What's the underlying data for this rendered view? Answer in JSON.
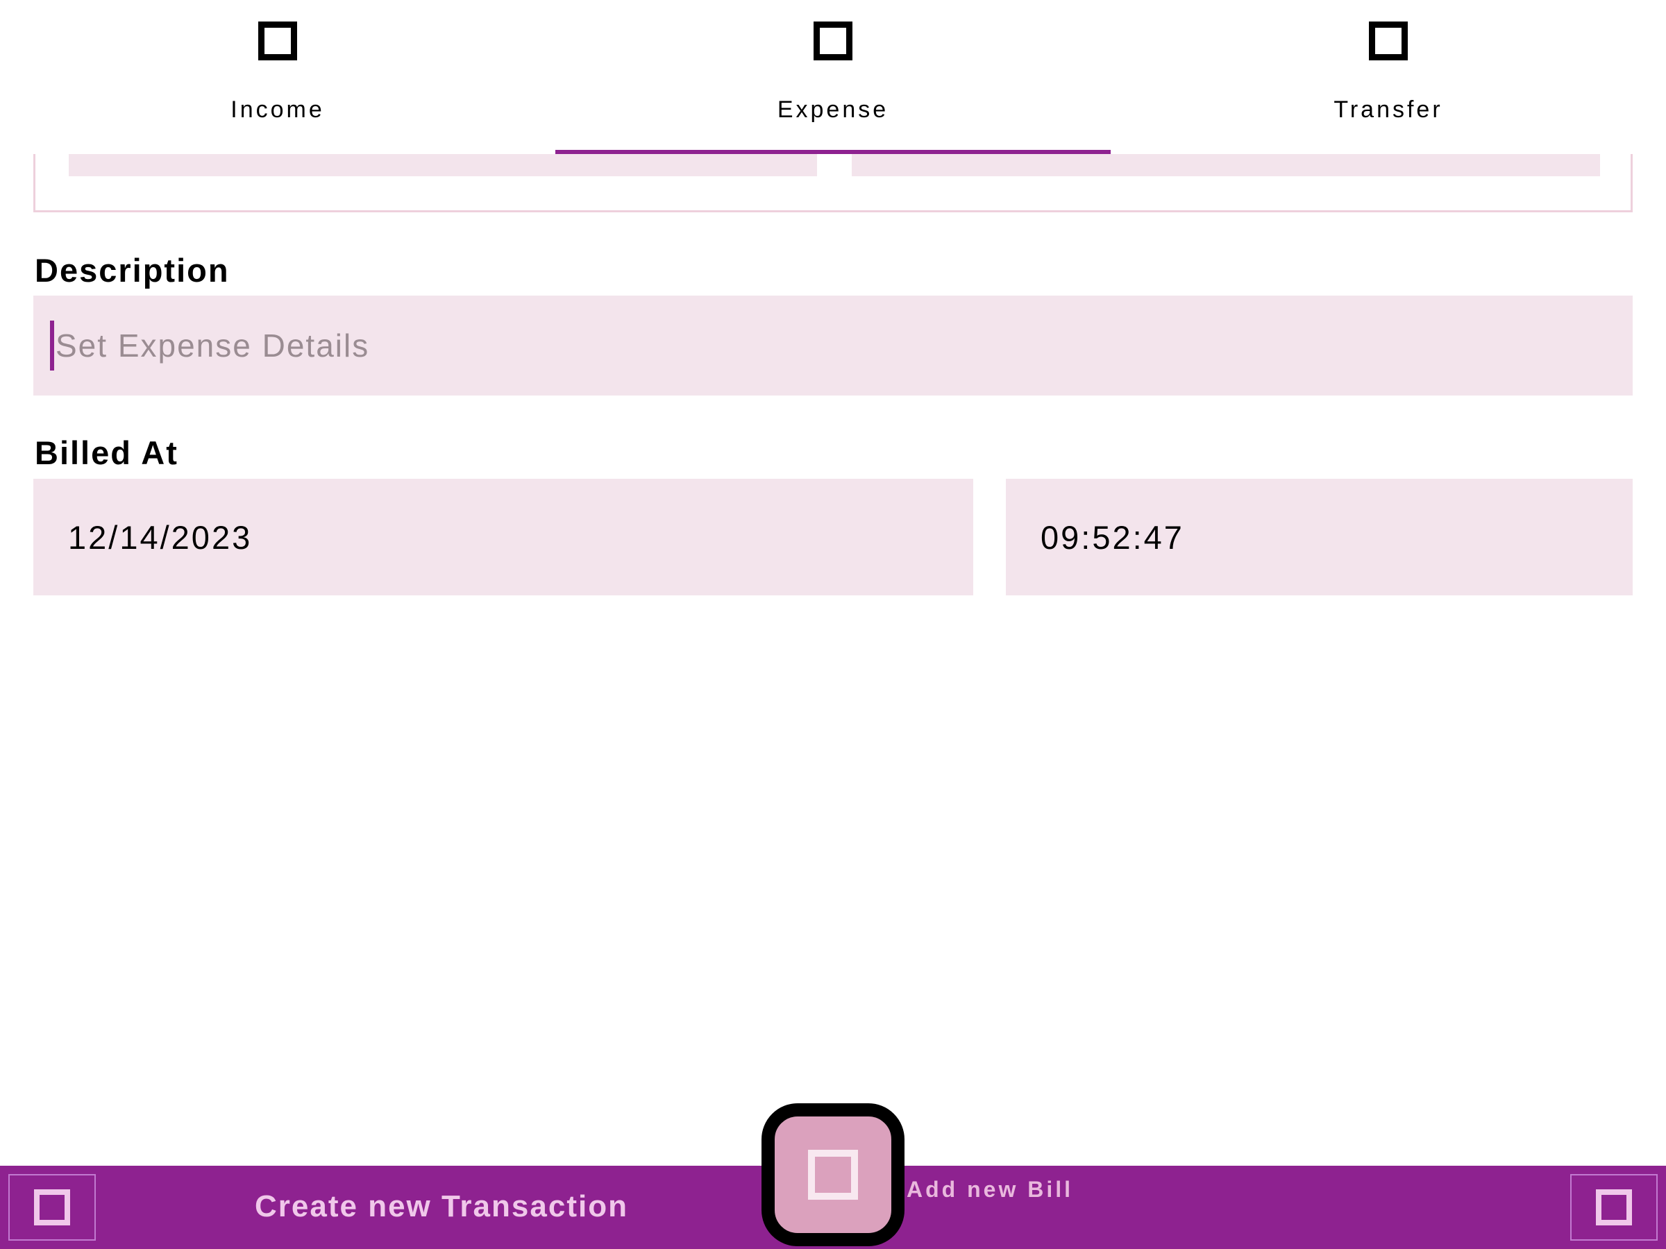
{
  "tabs": [
    {
      "label": "Income",
      "icon": "income-icon"
    },
    {
      "label": "Expense",
      "icon": "expense-icon"
    },
    {
      "label": "Transfer",
      "icon": "transfer-icon"
    }
  ],
  "selected_tab": "Expense",
  "colors": {
    "accent": "#8e2290",
    "field_bg": "#f3e4ec",
    "fab_bg": "#dba1bd",
    "bottom_bar_text": "#f0c8ea"
  },
  "description": {
    "label": "Description",
    "placeholder": "Set Expense Details",
    "value": ""
  },
  "billed_at": {
    "label": "Billed At",
    "date": "12/14/2023",
    "time": "09:52:47"
  },
  "bottom_bar": {
    "left_icon": "square-icon",
    "create_label": "Create new Transaction",
    "fab_icon": "square-icon",
    "add_bill_label": "Add new Bill",
    "right_icon": "square-icon"
  }
}
